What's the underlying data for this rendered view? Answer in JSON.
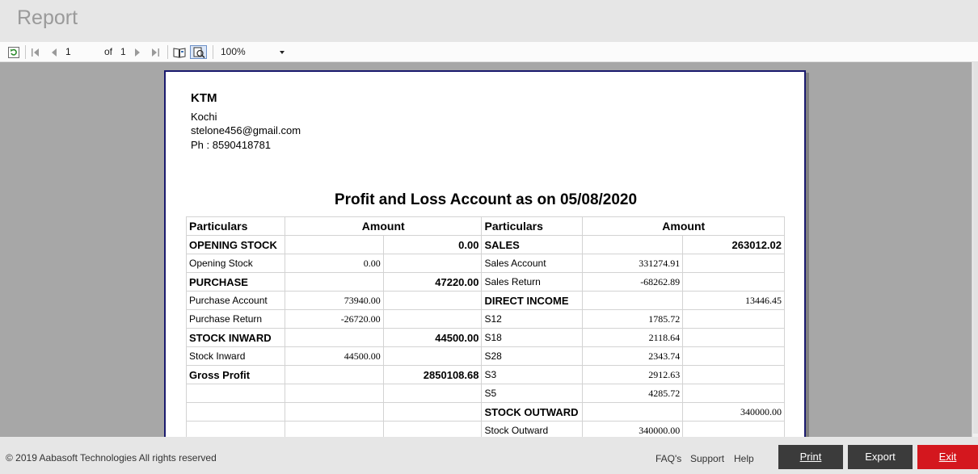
{
  "window": {
    "title": "Report"
  },
  "toolbar": {
    "page_current": "1",
    "of_label": "of",
    "page_total": "1",
    "zoom": "100%",
    "icons": [
      "refresh-icon",
      "first-page-icon",
      "prev-page-icon",
      "next-page-icon",
      "last-page-icon",
      "page-setup-icon",
      "print-layout-icon"
    ]
  },
  "report": {
    "company": "KTM",
    "city": "Kochi",
    "email": "stelone456@gmail.com",
    "phone": "Ph : 8590418781",
    "title": "Profit and Loss Account as on 05/08/2020",
    "headers": [
      "Particulars",
      "Amount",
      "Particulars",
      "Amount"
    ],
    "rows": [
      [
        {
          "t": "OPENING STOCK",
          "b": true
        },
        {
          "t": ""
        },
        {
          "t": "0.00",
          "b": true
        },
        {
          "t": "SALES",
          "b": true
        },
        {
          "t": ""
        },
        {
          "t": "263012.02",
          "b": true
        }
      ],
      [
        {
          "t": "Opening Stock"
        },
        {
          "t": "0.00"
        },
        {
          "t": ""
        },
        {
          "t": "Sales Account"
        },
        {
          "t": "331274.91"
        },
        {
          "t": ""
        }
      ],
      [
        {
          "t": "PURCHASE",
          "b": true
        },
        {
          "t": ""
        },
        {
          "t": "47220.00",
          "b": true
        },
        {
          "t": "Sales Return"
        },
        {
          "t": "-68262.89"
        },
        {
          "t": ""
        }
      ],
      [
        {
          "t": "Purchase Account"
        },
        {
          "t": "73940.00"
        },
        {
          "t": ""
        },
        {
          "t": "DIRECT INCOME",
          "b": true
        },
        {
          "t": ""
        },
        {
          "t": "13446.45"
        }
      ],
      [
        {
          "t": "Purchase Return"
        },
        {
          "t": "-26720.00"
        },
        {
          "t": ""
        },
        {
          "t": "S12"
        },
        {
          "t": "1785.72"
        },
        {
          "t": ""
        }
      ],
      [
        {
          "t": "STOCK INWARD",
          "b": true
        },
        {
          "t": ""
        },
        {
          "t": "44500.00",
          "b": true
        },
        {
          "t": "S18"
        },
        {
          "t": "2118.64"
        },
        {
          "t": ""
        }
      ],
      [
        {
          "t": "Stock Inward"
        },
        {
          "t": "44500.00"
        },
        {
          "t": ""
        },
        {
          "t": "S28"
        },
        {
          "t": "2343.74"
        },
        {
          "t": ""
        }
      ],
      [
        {
          "t": "Gross Profit",
          "b": true
        },
        {
          "t": ""
        },
        {
          "t": "2850108.68",
          "b": true
        },
        {
          "t": "S3"
        },
        {
          "t": "2912.63"
        },
        {
          "t": ""
        }
      ],
      [
        {
          "t": ""
        },
        {
          "t": ""
        },
        {
          "t": ""
        },
        {
          "t": "S5"
        },
        {
          "t": "4285.72"
        },
        {
          "t": ""
        }
      ],
      [
        {
          "t": ""
        },
        {
          "t": ""
        },
        {
          "t": ""
        },
        {
          "t": "STOCK OUTWARD",
          "b": true
        },
        {
          "t": ""
        },
        {
          "t": "340000.00"
        }
      ],
      [
        {
          "t": ""
        },
        {
          "t": ""
        },
        {
          "t": ""
        },
        {
          "t": "Stock Outward"
        },
        {
          "t": "340000.00"
        },
        {
          "t": ""
        }
      ]
    ]
  },
  "footer": {
    "copyright": "© 2019 Aabasoft Technologies All rights reserved",
    "links": [
      "FAQ's",
      "Support",
      "Help"
    ],
    "print_label": "Print",
    "export_label": "Export",
    "exit_label": "Exit"
  },
  "colors": {
    "exit_button": "#d4171e",
    "button_dark": "#3b3b3b",
    "viewport_bg": "#a7a7a7",
    "paper_border": "#1a1a6e"
  }
}
